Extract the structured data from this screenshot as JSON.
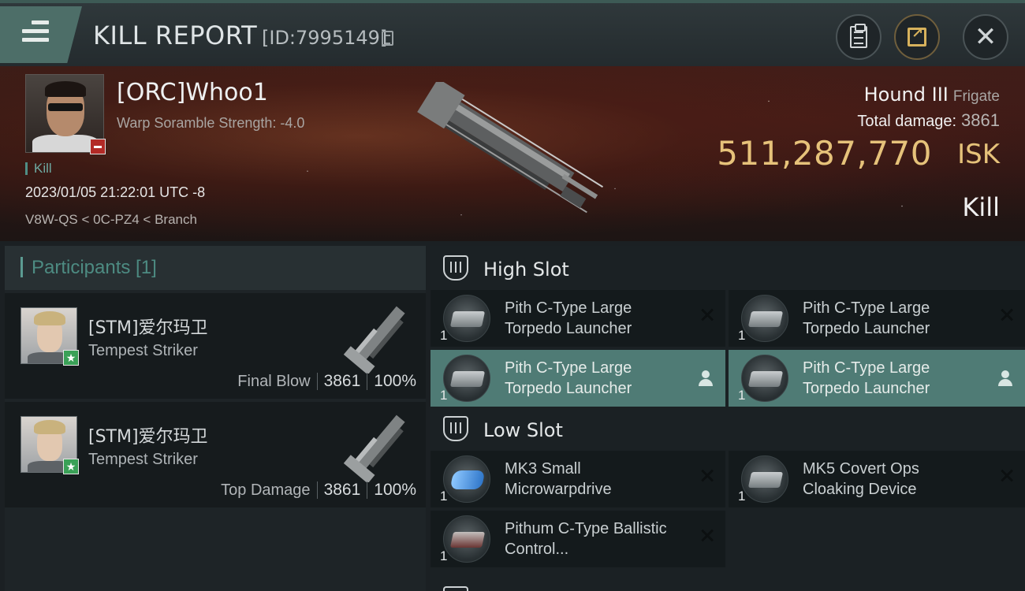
{
  "titlebar": {
    "title": "KILL REPORT",
    "report_id": "[ID:7995149]",
    "icons": [
      "menu-icon",
      "copy-icon",
      "clipboard-icon",
      "share-icon",
      "close-icon"
    ]
  },
  "victim": {
    "name": "[ORC]Whoo1",
    "stat": "Warp Soramble Strength: -4.0",
    "tag": "Kill",
    "datetime": "2023/01/05 21:22:01 UTC -8",
    "location": "V8W-QS < 0C-PZ4 < Branch",
    "ship_name": "Hound III",
    "ship_class": "Frigate",
    "total_damage_label": "Total damage:",
    "total_damage": "3861",
    "isk_value": "511,287,770",
    "isk_unit": "ISK",
    "result": "Kill"
  },
  "participants": {
    "header": "Participants [1]",
    "rows": [
      {
        "name": "[STM]爱尔玛卫",
        "ship": "Tempest Striker",
        "role": "Final Blow",
        "damage": "3861",
        "percent": "100%"
      },
      {
        "name": "[STM]爱尔玛卫",
        "ship": "Tempest Striker",
        "role": "Top Damage",
        "damage": "3861",
        "percent": "100%"
      }
    ]
  },
  "fitting": {
    "high_slot": {
      "label": "High Slot",
      "modules": [
        {
          "name": "Pith C-Type Large Torpedo Launcher",
          "qty": "1",
          "highlighted": false
        },
        {
          "name": "Pith C-Type Large Torpedo Launcher",
          "qty": "1",
          "highlighted": false
        },
        {
          "name": "Pith C-Type Large Torpedo Launcher",
          "qty": "1",
          "highlighted": true
        },
        {
          "name": "Pith C-Type Large Torpedo Launcher",
          "qty": "1",
          "highlighted": true
        }
      ]
    },
    "low_slot": {
      "label": "Low Slot",
      "modules": [
        {
          "name": "MK3 Small Microwarpdrive",
          "qty": "1",
          "highlighted": false
        },
        {
          "name": "MK5 Covert Ops Cloaking Device",
          "qty": "1",
          "highlighted": false
        },
        {
          "name": "Pithum C-Type Ballistic Control...",
          "qty": "1",
          "highlighted": false
        }
      ]
    }
  },
  "colors": {
    "accent_teal": "#4f7b75",
    "isk_gold": "#e6c27a",
    "loss_red": "#b22a26",
    "star_green": "#3aa157"
  }
}
